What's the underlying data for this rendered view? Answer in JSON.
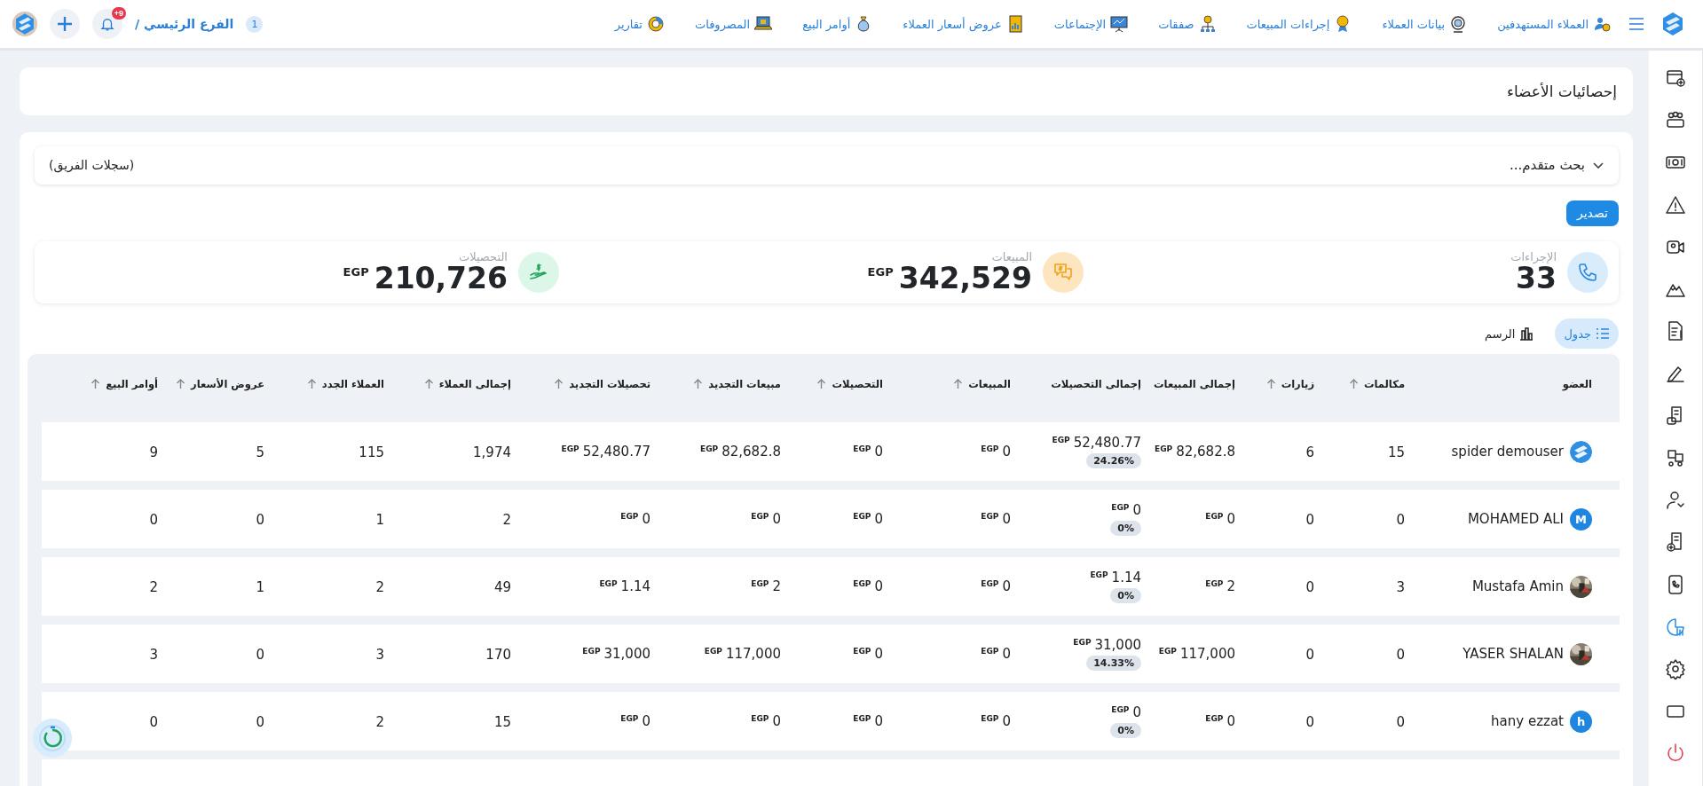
{
  "topbar": {
    "nav": [
      {
        "label": "العملاء المستهدفين"
      },
      {
        "label": "بيانات العملاء"
      },
      {
        "label": "إجراءات المبيعات"
      },
      {
        "label": "صفقات"
      },
      {
        "label": "الإجتماعات"
      },
      {
        "label": "عروض أسعار العملاء"
      },
      {
        "label": "أوامر البيع"
      },
      {
        "label": "المصروفات"
      },
      {
        "label": "تقارير"
      }
    ],
    "branch": {
      "count": "1",
      "label": "الفرع الرئيسي /"
    },
    "notifications": {
      "badge": "+9"
    }
  },
  "sidebar": {
    "items": [
      {
        "selected": false
      },
      {
        "selected": false
      },
      {
        "selected": false
      },
      {
        "selected": false
      },
      {
        "selected": false
      },
      {
        "selected": false
      },
      {
        "selected": false
      },
      {
        "selected": false
      },
      {
        "selected": false
      },
      {
        "selected": false
      },
      {
        "selected": false
      },
      {
        "selected": false
      },
      {
        "selected": false
      },
      {
        "selected": true
      },
      {
        "selected": false
      },
      {
        "selected": false
      },
      {
        "selected": false
      }
    ]
  },
  "page_title": "إحصائيات الأعضاء",
  "search": {
    "label": "بحث متقدم...",
    "scope": "(سجلات الفريق)",
    "expanded": false
  },
  "export_button": "تصدير",
  "stats": [
    {
      "kind": "calls",
      "label": "الإجراءات",
      "value": "33"
    },
    {
      "kind": "sales",
      "label": "المبيعات",
      "value": "342,529",
      "currency": "EGP"
    },
    {
      "kind": "collections",
      "label": "التحصيلات",
      "value": "210,726",
      "currency": "EGP"
    }
  ],
  "view_tabs": [
    {
      "kind": "table",
      "label": "جدول",
      "selected": true
    },
    {
      "kind": "chart",
      "label": "الرسم",
      "selected": false
    }
  ],
  "table": {
    "columns": [
      {
        "label": "العضو",
        "sortable": false
      },
      {
        "label": "مكالمات",
        "sortable": true
      },
      {
        "label": "زيارات",
        "sortable": true
      },
      {
        "label": "إجمالى المبيعات",
        "sortable": false
      },
      {
        "label": "إجمالى التحصيلات",
        "sortable": false
      },
      {
        "label": "المبيعات",
        "sortable": true
      },
      {
        "label": "التحصيلات",
        "sortable": true
      },
      {
        "label": "مبيعات التجديد",
        "sortable": true
      },
      {
        "label": "تحصيلات التجديد",
        "sortable": true
      },
      {
        "label": "إجمالى العملاء",
        "sortable": true
      },
      {
        "label": "العملاء الجدد",
        "sortable": true
      },
      {
        "label": "عروض الأسعار",
        "sortable": true
      },
      {
        "label": "أوامر البيع",
        "sortable": true
      }
    ],
    "rows": [
      {
        "cells": [
          {
            "kind": "member",
            "name": "spider demouser",
            "avatar": {
              "kind": "logo"
            }
          },
          {
            "kind": "number",
            "text": "15"
          },
          {
            "kind": "number",
            "text": "6"
          },
          {
            "kind": "money",
            "currency": "EGP",
            "amount": "82,682.8"
          },
          {
            "kind": "money",
            "currency": "EGP",
            "amount": "52,480.77",
            "share": "24.26%"
          },
          {
            "kind": "money",
            "currency": "EGP",
            "amount": "0"
          },
          {
            "kind": "money",
            "currency": "EGP",
            "amount": "0"
          },
          {
            "kind": "money",
            "currency": "EGP",
            "amount": "82,682.8"
          },
          {
            "kind": "money",
            "currency": "EGP",
            "amount": "52,480.77"
          },
          {
            "kind": "number",
            "text": "1,974"
          },
          {
            "kind": "number",
            "text": "115"
          },
          {
            "kind": "number",
            "text": "5"
          },
          {
            "kind": "number",
            "text": "9"
          }
        ]
      },
      {
        "cells": [
          {
            "kind": "member",
            "name": "MOHAMED ALI",
            "avatar": {
              "kind": "letter",
              "letter": "M"
            }
          },
          {
            "kind": "number",
            "text": "0"
          },
          {
            "kind": "number",
            "text": "0"
          },
          {
            "kind": "money",
            "currency": "EGP",
            "amount": "0"
          },
          {
            "kind": "money",
            "currency": "EGP",
            "amount": "0",
            "share": "0%"
          },
          {
            "kind": "money",
            "currency": "EGP",
            "amount": "0"
          },
          {
            "kind": "money",
            "currency": "EGP",
            "amount": "0"
          },
          {
            "kind": "money",
            "currency": "EGP",
            "amount": "0"
          },
          {
            "kind": "money",
            "currency": "EGP",
            "amount": "0"
          },
          {
            "kind": "number",
            "text": "2"
          },
          {
            "kind": "number",
            "text": "1"
          },
          {
            "kind": "number",
            "text": "0"
          },
          {
            "kind": "number",
            "text": "0"
          }
        ]
      },
      {
        "cells": [
          {
            "kind": "member",
            "name": "Mustafa Amin"
          },
          {
            "kind": "number",
            "text": "3"
          },
          {
            "kind": "number",
            "text": "0"
          },
          {
            "kind": "money",
            "currency": "EGP",
            "amount": "2"
          },
          {
            "kind": "money",
            "currency": "EGP",
            "amount": "1.14",
            "share": "0%"
          },
          {
            "kind": "money",
            "currency": "EGP",
            "amount": "0"
          },
          {
            "kind": "money",
            "currency": "EGP",
            "amount": "0"
          },
          {
            "kind": "money",
            "currency": "EGP",
            "amount": "2"
          },
          {
            "kind": "money",
            "currency": "EGP",
            "amount": "1.14"
          },
          {
            "kind": "number",
            "text": "49"
          },
          {
            "kind": "number",
            "text": "2"
          },
          {
            "kind": "number",
            "text": "1"
          },
          {
            "kind": "number",
            "text": "2"
          }
        ]
      },
      {
        "cells": [
          {
            "kind": "member",
            "name": "YASER SHALAN"
          },
          {
            "kind": "number",
            "text": "0"
          },
          {
            "kind": "number",
            "text": "0"
          },
          {
            "kind": "money",
            "currency": "EGP",
            "amount": "117,000"
          },
          {
            "kind": "money",
            "currency": "EGP",
            "amount": "31,000",
            "share": "14.33%"
          },
          {
            "kind": "money",
            "currency": "EGP",
            "amount": "0"
          },
          {
            "kind": "money",
            "currency": "EGP",
            "amount": "0"
          },
          {
            "kind": "money",
            "currency": "EGP",
            "amount": "117,000"
          },
          {
            "kind": "money",
            "currency": "EGP",
            "amount": "31,000"
          },
          {
            "kind": "number",
            "text": "170"
          },
          {
            "kind": "number",
            "text": "3"
          },
          {
            "kind": "number",
            "text": "0"
          },
          {
            "kind": "number",
            "text": "3"
          }
        ]
      },
      {
        "cells": [
          {
            "kind": "member",
            "name": "hany ezzat",
            "avatar": {
              "kind": "letter",
              "letter": "h"
            }
          },
          {
            "kind": "number",
            "text": "0"
          },
          {
            "kind": "number",
            "text": "0"
          },
          {
            "kind": "money",
            "currency": "EGP",
            "amount": "0"
          },
          {
            "kind": "money",
            "currency": "EGP",
            "amount": "0",
            "share": "0%"
          },
          {
            "kind": "money",
            "currency": "EGP",
            "amount": "0"
          },
          {
            "kind": "money",
            "currency": "EGP",
            "amount": "0"
          },
          {
            "kind": "money",
            "currency": "EGP",
            "amount": "0"
          },
          {
            "kind": "money",
            "currency": "EGP",
            "amount": "0"
          },
          {
            "kind": "number",
            "text": "15"
          },
          {
            "kind": "number",
            "text": "2"
          },
          {
            "kind": "number",
            "text": "0"
          },
          {
            "kind": "number",
            "text": "0"
          }
        ]
      }
    ]
  }
}
